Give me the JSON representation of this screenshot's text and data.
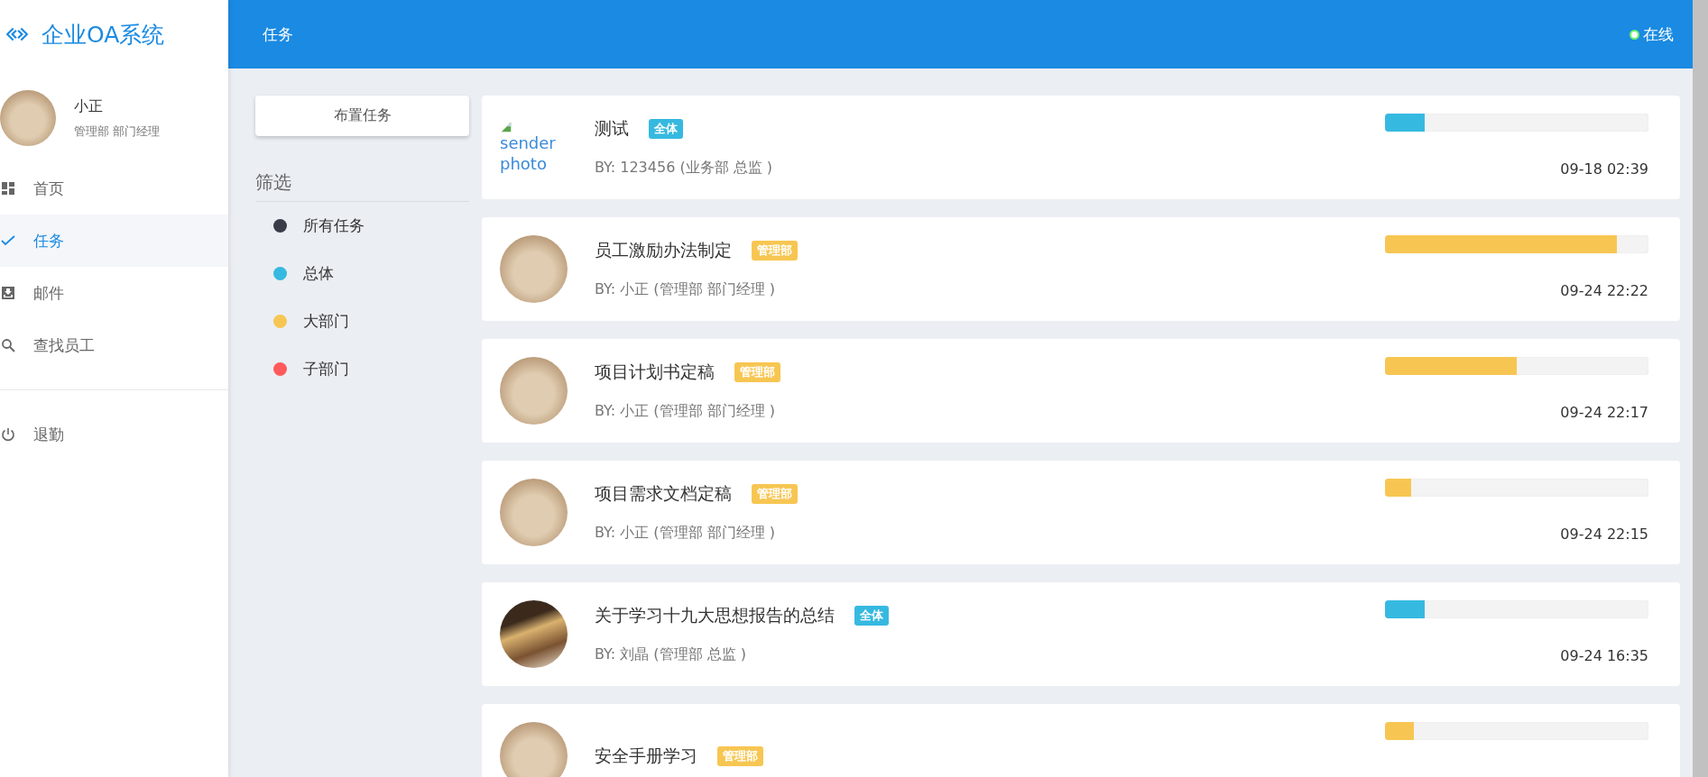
{
  "brand": {
    "title": "企业OA系统"
  },
  "user": {
    "name": "小正",
    "role": "管理部 部门经理"
  },
  "nav": [
    {
      "label": "首页",
      "kind": "dashboard",
      "selected": false
    },
    {
      "label": "任务",
      "kind": "check",
      "selected": true
    },
    {
      "label": "邮件",
      "kind": "inbox",
      "selected": false
    },
    {
      "label": "查找员工",
      "kind": "search",
      "selected": false
    }
  ],
  "logout": {
    "label": "退勤"
  },
  "header": {
    "title": "任务",
    "status": "在线"
  },
  "assign_button": "布置任务",
  "filter": {
    "title": "筛选",
    "items": [
      {
        "label": "所有任务",
        "color": "#3a3d48"
      },
      {
        "label": "总体",
        "color": "#36b9e0"
      },
      {
        "label": "大部门",
        "color": "#f7c652"
      },
      {
        "label": "子部门",
        "color": "#ff5a5a"
      }
    ]
  },
  "tasks": [
    {
      "kind": "broken",
      "alt": "sender photo",
      "title": "测试",
      "tag": "全体",
      "color": "#36b9e0",
      "by": "BY: 123456 (业务部 总监 )",
      "level": 0.15,
      "time": "09-18 02:39"
    },
    {
      "kind": "face",
      "title": "员工激励办法制定",
      "tag": "管理部",
      "color": "#f7c652",
      "by": "BY: 小正 (管理部 部门经理 )",
      "level": 0.88,
      "time": "09-24 22:22"
    },
    {
      "kind": "face",
      "title": "项目计划书定稿",
      "tag": "管理部",
      "color": "#f7c652",
      "by": "BY: 小正 (管理部 部门经理 )",
      "level": 0.5,
      "time": "09-24 22:17"
    },
    {
      "kind": "face",
      "title": "项目需求文档定稿",
      "tag": "管理部",
      "color": "#f7c652",
      "by": "BY: 小正 (管理部 部门经理 )",
      "level": 0.1,
      "time": "09-24 22:15"
    },
    {
      "kind": "photo",
      "title": "关于学习十九大思想报告的总结",
      "tag": "全体",
      "color": "#36b9e0",
      "by": "BY: 刘晶 (管理部 总监 )",
      "level": 0.15,
      "time": "09-24 16:35"
    },
    {
      "kind": "face",
      "title": "安全手册学习",
      "tag": "管理部",
      "color": "#f7c652",
      "level": 0.11
    }
  ]
}
